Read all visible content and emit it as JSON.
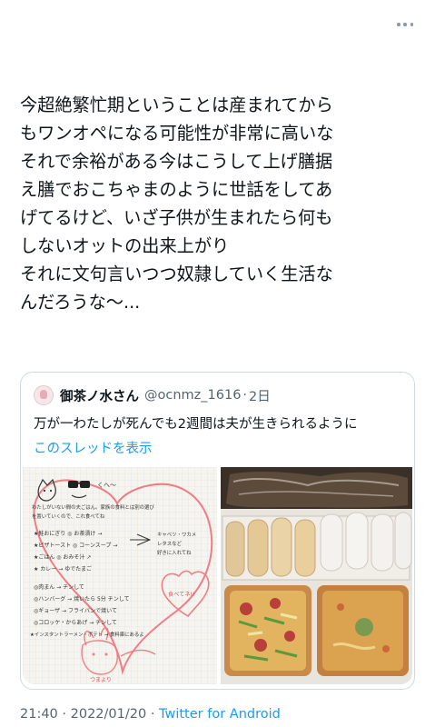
{
  "tweet": {
    "text_lines": [
      "今超絶繁忙期ということは産まれてから",
      "もワンオペになる可能性が非常に高いな",
      "それで余裕がある今はこうして上げ膳据",
      "え膳でおこちゃまのように世話をしてあ",
      "げてるけど、いざ子供が生まれたら何も",
      "しないオットの出来上がり",
      "それに文句言いつつ奴隷していく生活な",
      "んだろうな〜..."
    ],
    "time": "21:40",
    "date": "2022/01/20",
    "separator": "·",
    "source": "Twitter for Android"
  },
  "quote": {
    "name": "御茶ノ水さん",
    "handle": "@ocnmz_1616",
    "separator": "·",
    "date": "2日",
    "text": "万が一わたしが死んでも2週間は夫が生きられるように",
    "thread_link": "このスレッドを表示"
  },
  "note_image": {
    "greeting": "くへ〜",
    "intro": [
      "わたしがいない間の夫ごはん。家族の食料とは別の選び",
      "を置いていくので、これ食べてね"
    ],
    "items": [
      "★鮭おにぎり ◎ お茶漬け →",
      "★ピザトースト ◎ コーンスープ →",
      "★ごはん ◎ おみそ汁 ↗",
      "★ カレー → ゆでたまご",
      "◎肉まん → チンして",
      "◎ハンバーグ → 焼いたら 5分 チンして",
      "◎ギョーザ → フライパンで焼いて",
      "◎コロッケ・からあげ → チンして",
      "★インスタントラーメン・ポテト → 食料庫にあるよ"
    ],
    "side_note": [
      "キャベツ・ワカメ",
      "レタスなど",
      "好きに入れてね"
    ],
    "heart_note": "食べてネ!!",
    "signature": "つまより"
  }
}
